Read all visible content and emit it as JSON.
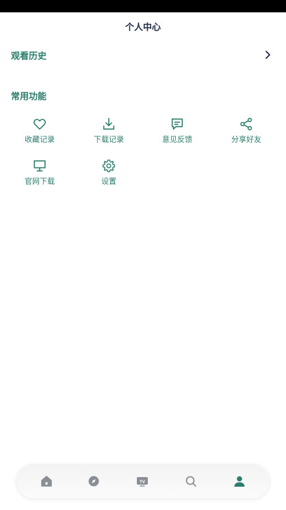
{
  "header": {
    "title": "个人中心"
  },
  "history": {
    "label": "观看历史"
  },
  "common": {
    "title": "常用功能",
    "items": [
      {
        "label": "收藏记录",
        "icon": "heart-icon"
      },
      {
        "label": "下载记录",
        "icon": "download-icon"
      },
      {
        "label": "意见反馈",
        "icon": "feedback-icon"
      },
      {
        "label": "分享好友",
        "icon": "share-icon"
      },
      {
        "label": "官网下载",
        "icon": "monitor-icon"
      },
      {
        "label": "设置",
        "icon": "gear-icon"
      }
    ]
  },
  "tabbar": {
    "items": [
      {
        "icon": "home-icon",
        "active": false
      },
      {
        "icon": "compass-icon",
        "active": false
      },
      {
        "icon": "tv-icon",
        "label": "TV",
        "active": false
      },
      {
        "icon": "search-icon",
        "active": false
      },
      {
        "icon": "user-icon",
        "active": true
      }
    ]
  },
  "colors": {
    "accent": "#2e7d6c",
    "title": "#1f2a44",
    "tab_inactive": "#8a8f95"
  }
}
